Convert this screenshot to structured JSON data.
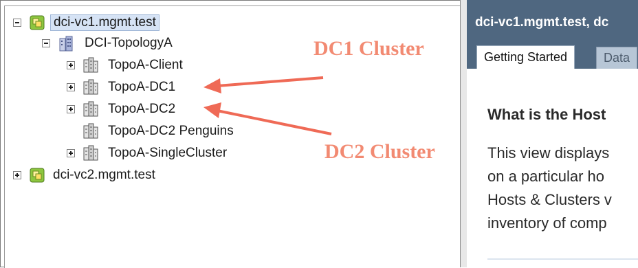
{
  "tree": {
    "items": [
      {
        "label": "dci-vc1.mgmt.test",
        "icon": "vcenter-icon",
        "expander": "minus",
        "selected": true
      },
      {
        "label": "DCI-TopologyA",
        "icon": "datacenter-icon",
        "expander": "minus"
      },
      {
        "label": "TopoA-Client",
        "icon": "cluster-icon",
        "expander": "plus"
      },
      {
        "label": "TopoA-DC1",
        "icon": "cluster-icon",
        "expander": "plus"
      },
      {
        "label": "TopoA-DC2",
        "icon": "cluster-icon",
        "expander": "plus"
      },
      {
        "label": "TopoA-DC2 Penguins",
        "icon": "cluster-icon",
        "expander": "none"
      },
      {
        "label": "TopoA-SingleCluster",
        "icon": "cluster-icon",
        "expander": "plus"
      },
      {
        "label": "dci-vc2.mgmt.test",
        "icon": "vcenter-icon",
        "expander": "plus"
      }
    ]
  },
  "annotations": {
    "dc1": "DC1 Cluster",
    "dc2": "DC2 Cluster",
    "color": "#f28a72"
  },
  "right_pane": {
    "title": "dci-vc1.mgmt.test, dc",
    "tabs": [
      {
        "label": "Getting Started",
        "active": true
      },
      {
        "label": "Data",
        "active": false
      }
    ],
    "heading": "What is the Host",
    "body_lines": [
      "This view displays",
      "on a particular ho",
      "Hosts & Clusters v",
      "inventory of comp"
    ],
    "header_color": "#4f6780"
  }
}
